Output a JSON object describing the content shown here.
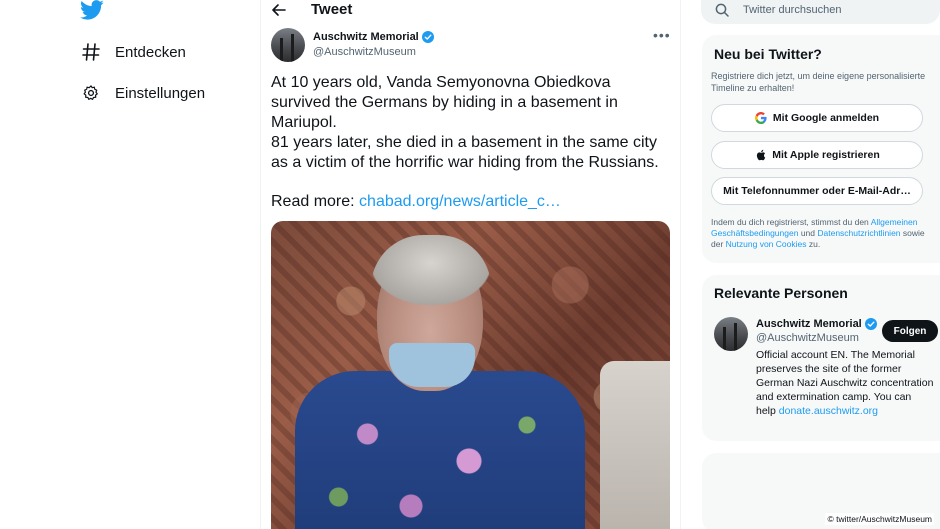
{
  "nav": {
    "items": [
      {
        "label": "Entdecken",
        "icon": "hashtag-icon"
      },
      {
        "label": "Einstellungen",
        "icon": "gear-icon"
      }
    ]
  },
  "header": {
    "title": "Tweet"
  },
  "tweet": {
    "author_name": "Auschwitz Memorial",
    "author_handle": "@AuschwitzMuseum",
    "lines": [
      "At 10 years old, Vanda Semyonovna Obiedkova",
      "survived the Germans by hiding in a basement in",
      "Mariupol.",
      "81 years later, she died in a basement in the same city",
      "as a victim of the horrific war hiding from the Russians."
    ],
    "read_more_label": "Read more:",
    "read_more_link": "chabad.org/news/article_c…"
  },
  "search": {
    "placeholder": "Twitter durchsuchen"
  },
  "signup": {
    "title": "Neu bei Twitter?",
    "subtitle": "Registriere dich jetzt, um deine eigene personalisierte Timeline zu erhalten!",
    "google_label": "Mit Google anmelden",
    "apple_label": "Mit Apple registrieren",
    "phone_label": "Mit Telefonnummer oder E-Mail-Adr…",
    "terms_prefix": "Indem du dich registrierst, stimmst du den",
    "terms_link": "Allgemeinen Geschäftsbedingungen",
    "terms_and": "und",
    "privacy_link": "Datenschutzrichtlinien",
    "terms_middle": "sowie der",
    "cookies_link": "Nutzung von Cookies",
    "terms_suffix": "zu."
  },
  "people": {
    "title": "Relevante Personen",
    "name": "Auschwitz Memorial",
    "handle": "@AuschwitzMuseum",
    "follow_label": "Folgen",
    "bio": "Official account EN. The Memorial preserves the site of the former German Nazi Auschwitz concentration and extermination camp. You can help",
    "bio_link": "donate.auschwitz.org"
  },
  "credit": "© twitter/AuschwitzMuseum",
  "colors": {
    "accent": "#1d9bf0",
    "text": "#0f1419",
    "muted": "#536471"
  }
}
